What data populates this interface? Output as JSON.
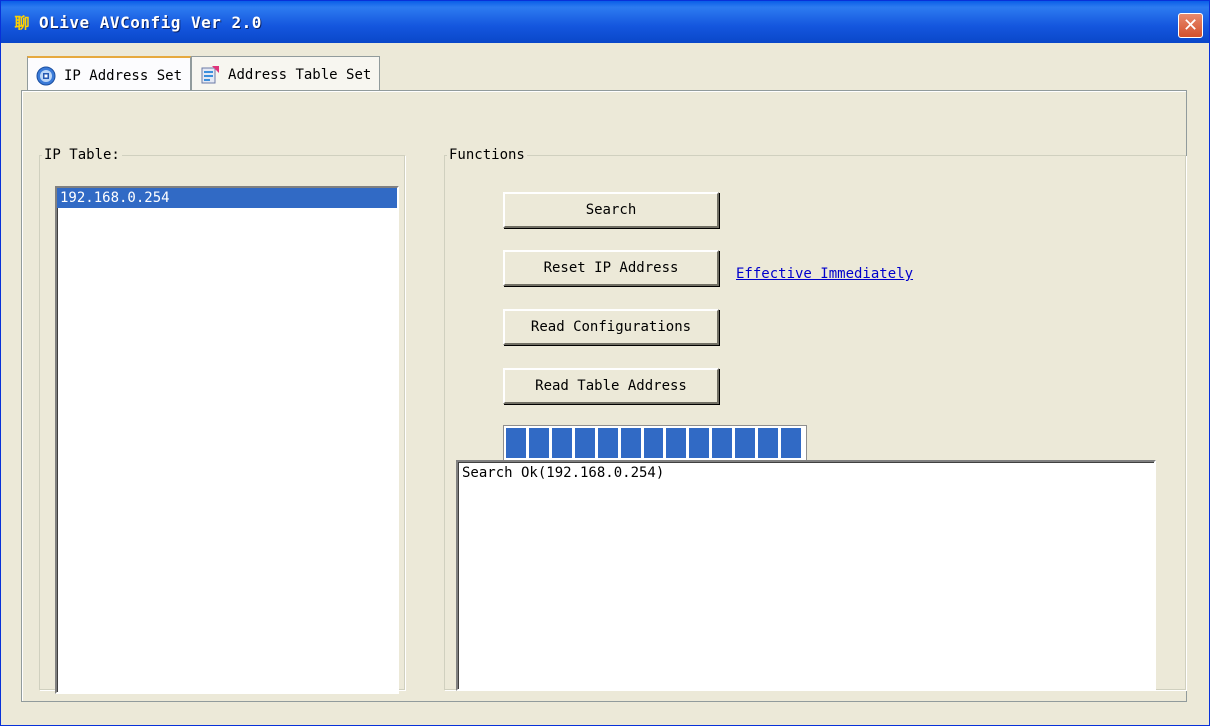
{
  "window": {
    "title": "OLive AVConfig Ver 2.0",
    "icon_glyph": "聊",
    "close_glyph": "✕"
  },
  "tabs": [
    {
      "label": "IP Address Set",
      "icon": "network-icon",
      "active": true
    },
    {
      "label": "Address Table Set",
      "icon": "table-icon",
      "active": false
    }
  ],
  "ip_table": {
    "label": "IP Table:",
    "items": [
      "192.168.0.254"
    ],
    "selected_index": 0
  },
  "functions": {
    "label": "Functions",
    "search_label": "Search",
    "reset_ip_label": "Reset IP Address",
    "effective_link": "Effective Immediately",
    "read_config_label": "Read Configurations",
    "read_table_label": "Read Table Address"
  },
  "progress": {
    "fraction": 1.0,
    "blocks": 13,
    "color": "#316ac5"
  },
  "log": {
    "lines": [
      "Search Ok(192.168.0.254)"
    ]
  }
}
